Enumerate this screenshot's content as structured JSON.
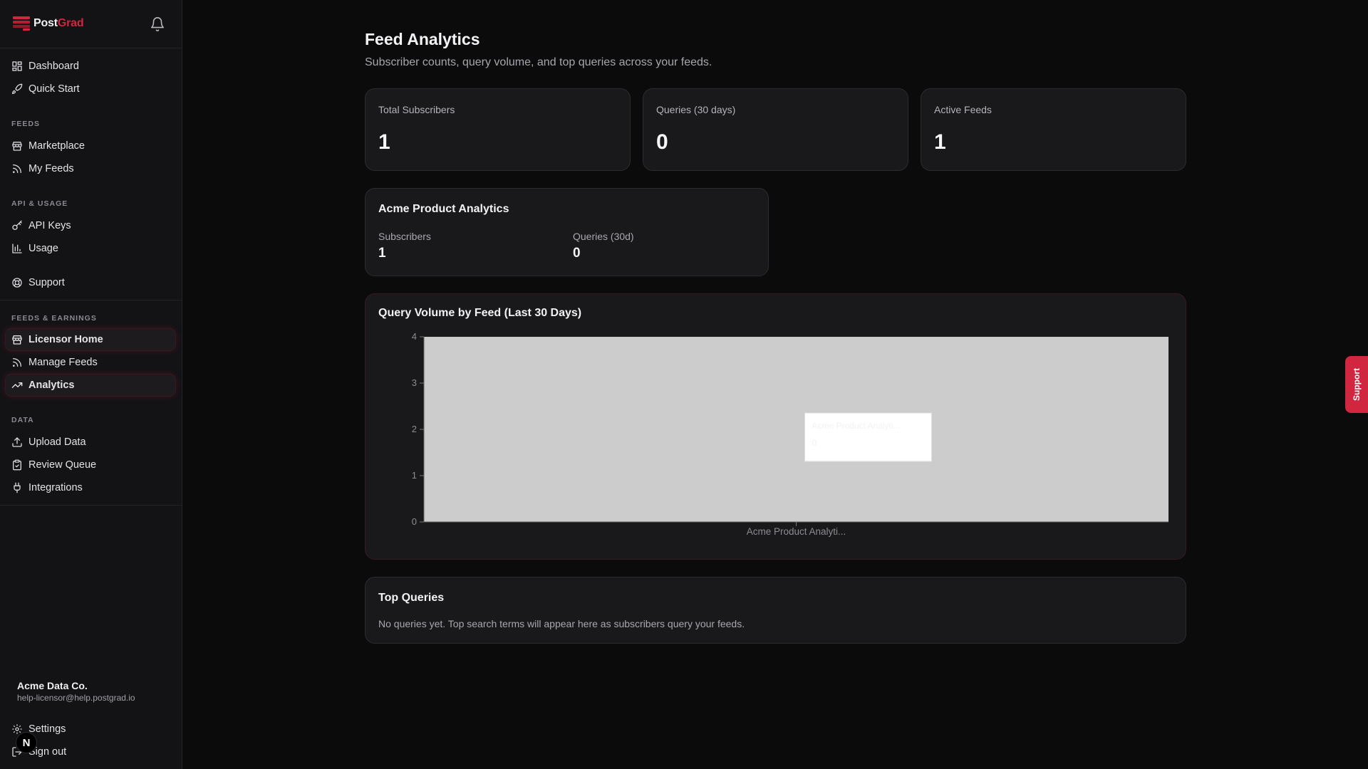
{
  "brand": {
    "name_part1": "Post",
    "name_part2": "Grad",
    "accent": "#d1263f"
  },
  "sidebar": {
    "top_items": [
      {
        "label": "Dashboard",
        "icon": "dashboard-icon"
      },
      {
        "label": "Quick Start",
        "icon": "rocket-icon"
      }
    ],
    "sections": {
      "feeds": {
        "label": "FEEDS",
        "items": [
          {
            "label": "Marketplace",
            "icon": "store-icon"
          },
          {
            "label": "My Feeds",
            "icon": "rss-icon"
          }
        ]
      },
      "api": {
        "label": "API & USAGE",
        "items": [
          {
            "label": "API Keys",
            "icon": "key-icon"
          },
          {
            "label": "Usage",
            "icon": "bar-chart-icon"
          }
        ]
      },
      "support_item": {
        "label": "Support",
        "icon": "lifebuoy-icon"
      },
      "earnings": {
        "label": "FEEDS & EARNINGS",
        "items": [
          {
            "label": "Licensor Home",
            "icon": "store-icon",
            "active": true
          },
          {
            "label": "Manage Feeds",
            "icon": "rss-icon"
          },
          {
            "label": "Analytics",
            "icon": "trending-up-icon",
            "active": true
          }
        ]
      },
      "data": {
        "label": "DATA",
        "items": [
          {
            "label": "Upload Data",
            "icon": "upload-icon"
          },
          {
            "label": "Review Queue",
            "icon": "clipboard-icon"
          },
          {
            "label": "Integrations",
            "icon": "plug-icon"
          }
        ]
      }
    },
    "account": {
      "name": "Acme Data Co.",
      "email": "help-licensor@help.postgrad.io"
    },
    "bottom_items": [
      {
        "label": "Settings",
        "icon": "gear-icon"
      },
      {
        "label": "Sign out",
        "icon": "sign-out-icon"
      }
    ],
    "dev_badge": "N"
  },
  "page": {
    "title": "Feed Analytics",
    "subtitle": "Subscriber counts, query volume, and top queries across your feeds."
  },
  "stats": [
    {
      "label": "Total Subscribers",
      "value": "1"
    },
    {
      "label": "Queries (30 days)",
      "value": "0"
    },
    {
      "label": "Active Feeds",
      "value": "1"
    }
  ],
  "feed_card": {
    "title": "Acme Product Analytics",
    "subscribers_label": "Subscribers",
    "subscribers_value": "1",
    "queries_label": "Queries (30d)",
    "queries_value": "0"
  },
  "chart_card": {
    "title": "Query Volume by Feed (Last 30 Days)"
  },
  "chart_data": {
    "type": "bar",
    "title": "Query Volume by Feed (Last 30 Days)",
    "categories": [
      "Acme Product Analyti..."
    ],
    "values": [
      0
    ],
    "yticks": [
      0,
      1,
      2,
      3,
      4
    ],
    "ylim": [
      0,
      4
    ],
    "xlabel": "",
    "ylabel": "",
    "grid": false,
    "hover_fill": "#cccccc"
  },
  "top_queries": {
    "title": "Top Queries",
    "empty_text": "No queries yet. Top search terms will appear here as subscribers query your feeds."
  },
  "support_tab": {
    "label": "Support"
  }
}
